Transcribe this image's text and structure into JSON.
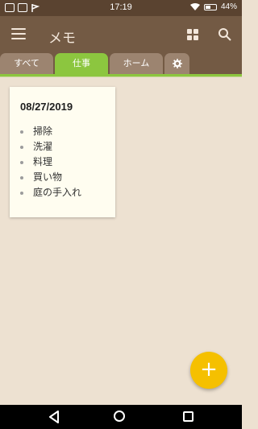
{
  "status_bar": {
    "time": "17:19",
    "battery": "44%"
  },
  "app_bar": {
    "title": "メモ"
  },
  "tabs": [
    {
      "label": "すべて",
      "active": false
    },
    {
      "label": "仕事",
      "active": true
    },
    {
      "label": "ホーム",
      "active": false
    },
    {
      "label": "",
      "icon": "gear-icon",
      "active": false
    }
  ],
  "note": {
    "date": "08/27/2019",
    "items": [
      "掃除",
      "洗濯",
      "料理",
      "買い物",
      "庭の手入れ"
    ]
  },
  "fab": {
    "label": "+"
  },
  "colors": {
    "status_bar": "#5a4330",
    "app_bar": "#735a44",
    "tab_active": "#8cc63f",
    "tab_inactive": "#9c8470",
    "background": "#ede1d1",
    "note": "#fffdf0",
    "fab": "#f5c000"
  }
}
